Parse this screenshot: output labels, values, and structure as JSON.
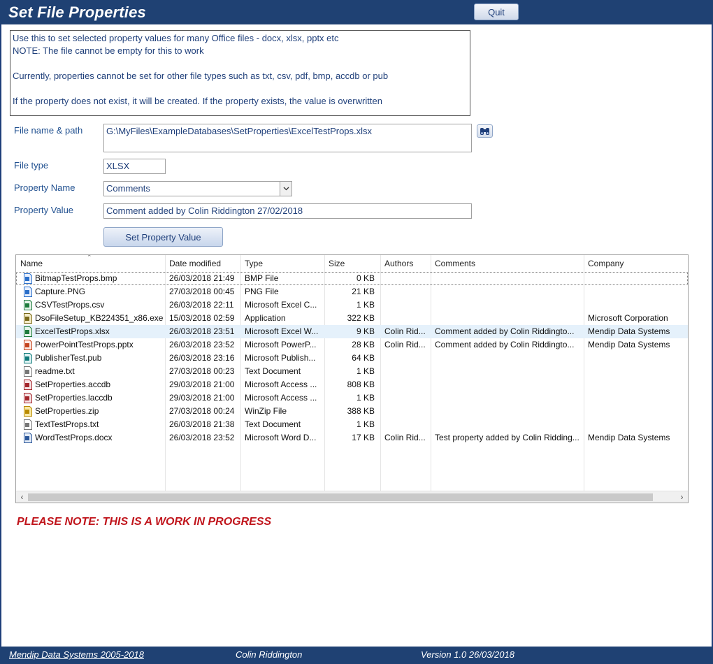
{
  "header": {
    "title": "Set File Properties",
    "quit_label": "Quit"
  },
  "info": {
    "lines": [
      "Use this to set selected property values for many Office files - docx, xlsx, pptx etc",
      "NOTE: The file cannot be empty for this to work",
      "",
      "Currently, properties cannot be set for other file types such as txt, csv, pdf, bmp, accdb or pub",
      "",
      "If the property does not exist, it will be created. If the property exists, the value is overwritten"
    ]
  },
  "form": {
    "file_name_label": "File name & path",
    "file_name_value": "G:\\MyFiles\\ExampleDatabases\\SetProperties\\ExcelTestProps.xlsx",
    "file_type_label": "File type",
    "file_type_value": "XLSX",
    "property_name_label": "Property Name",
    "property_name_value": "Comments",
    "property_value_label": "Property Value",
    "property_value_value": "Comment added by Colin Riddington 27/02/2018",
    "set_button_label": "Set Property Value"
  },
  "file_list": {
    "columns": [
      "Name",
      "Date modified",
      "Type",
      "Size",
      "Authors",
      "Comments",
      "Company"
    ],
    "rows": [
      {
        "name": "BitmapTestProps.bmp",
        "date": "26/03/2018 21:49",
        "type": "BMP File",
        "size": "0 KB",
        "authors": "",
        "comments": "",
        "company": "",
        "icon": "image-file-icon"
      },
      {
        "name": "Capture.PNG",
        "date": "27/03/2018 00:45",
        "type": "PNG File",
        "size": "21 KB",
        "authors": "",
        "comments": "",
        "company": "",
        "icon": "image-file-icon"
      },
      {
        "name": "CSVTestProps.csv",
        "date": "26/03/2018 22:11",
        "type": "Microsoft Excel C...",
        "size": "1 KB",
        "authors": "",
        "comments": "",
        "company": "",
        "icon": "excel-file-icon"
      },
      {
        "name": "DsoFileSetup_KB224351_x86.exe",
        "date": "15/03/2018 02:59",
        "type": "Application",
        "size": "322 KB",
        "authors": "",
        "comments": "",
        "company": "Microsoft Corporation",
        "icon": "installer-file-icon"
      },
      {
        "name": "ExcelTestProps.xlsx",
        "date": "26/03/2018 23:51",
        "type": "Microsoft Excel W...",
        "size": "9 KB",
        "authors": "Colin Rid...",
        "comments": "Comment added by Colin Riddingto...",
        "company": "Mendip Data Systems",
        "icon": "excel-file-icon"
      },
      {
        "name": "PowerPointTestProps.pptx",
        "date": "26/03/2018 23:52",
        "type": "Microsoft PowerP...",
        "size": "28 KB",
        "authors": "Colin Rid...",
        "comments": "Comment added by Colin Riddingto...",
        "company": "Mendip Data Systems",
        "icon": "powerpoint-file-icon"
      },
      {
        "name": "PublisherTest.pub",
        "date": "26/03/2018 23:16",
        "type": "Microsoft Publish...",
        "size": "64 KB",
        "authors": "",
        "comments": "",
        "company": "",
        "icon": "publisher-file-icon"
      },
      {
        "name": "readme.txt",
        "date": "27/03/2018 00:23",
        "type": "Text Document",
        "size": "1 KB",
        "authors": "",
        "comments": "",
        "company": "",
        "icon": "text-file-icon"
      },
      {
        "name": "SetProperties.accdb",
        "date": "29/03/2018 21:00",
        "type": "Microsoft Access ...",
        "size": "808 KB",
        "authors": "",
        "comments": "",
        "company": "",
        "icon": "access-file-icon"
      },
      {
        "name": "SetProperties.laccdb",
        "date": "29/03/2018 21:00",
        "type": "Microsoft Access ...",
        "size": "1 KB",
        "authors": "",
        "comments": "",
        "company": "",
        "icon": "access-lock-file-icon"
      },
      {
        "name": "SetProperties.zip",
        "date": "27/03/2018 00:24",
        "type": "WinZip File",
        "size": "388 KB",
        "authors": "",
        "comments": "",
        "company": "",
        "icon": "zip-file-icon"
      },
      {
        "name": "TextTestProps.txt",
        "date": "26/03/2018 21:38",
        "type": "Text Document",
        "size": "1 KB",
        "authors": "",
        "comments": "",
        "company": "",
        "icon": "text-file-icon"
      },
      {
        "name": "WordTestProps.docx",
        "date": "26/03/2018 23:52",
        "type": "Microsoft Word D...",
        "size": "17 KB",
        "authors": "Colin Rid...",
        "comments": "Test property added by Colin Ridding...",
        "company": "Mendip Data Systems",
        "icon": "word-file-icon"
      }
    ],
    "selected_row": 4,
    "focused_row": 0
  },
  "note": "PLEASE NOTE: THIS IS A WORK IN PROGRESS",
  "footer": {
    "company": "Mendip Data Systems 2005-2018",
    "author": "Colin Riddington",
    "version": "Version 1.0  26/03/2018"
  },
  "colors": {
    "header_bg": "#1f4173",
    "note_red": "#c0141b",
    "label_blue": "#1f4f8f"
  }
}
